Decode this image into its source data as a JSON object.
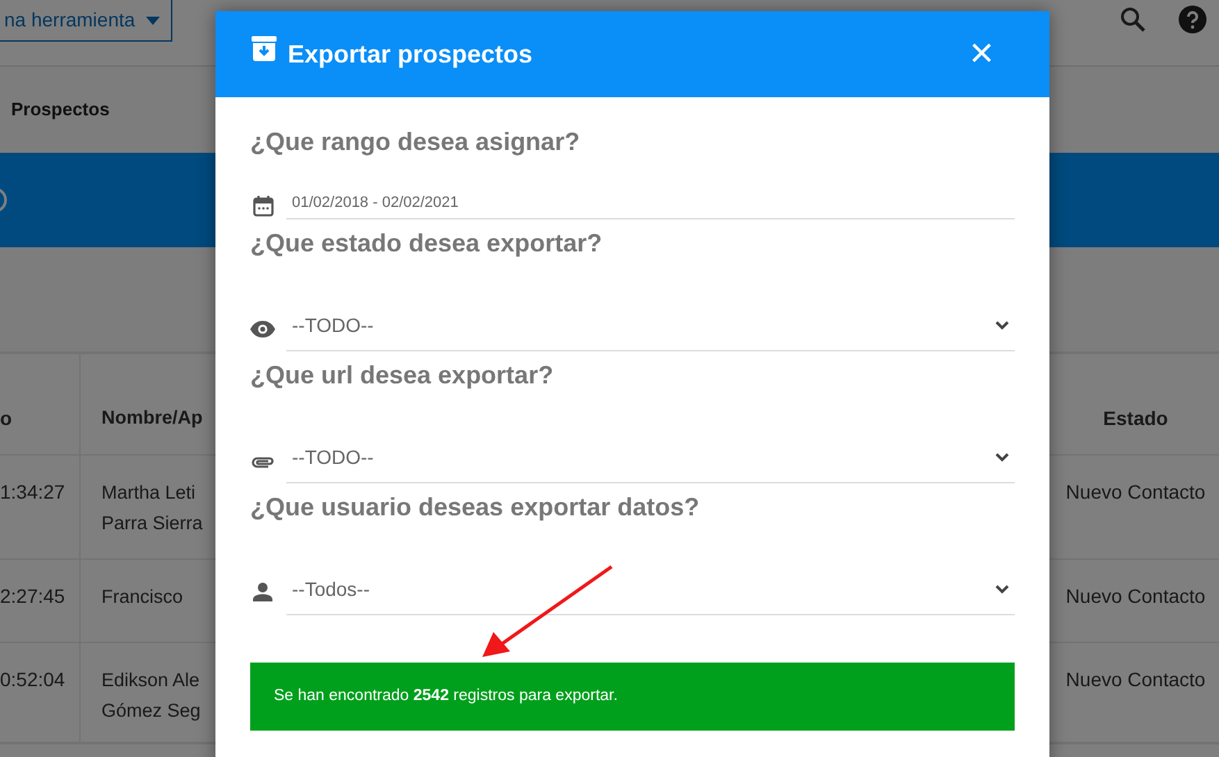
{
  "toolbar": {
    "tool_button": "na herramienta"
  },
  "page_title": "Prospectos",
  "table": {
    "columns": [
      "o",
      "Nombre/Ap",
      "Estado"
    ],
    "rows": [
      {
        "time": "1:34:27",
        "name": [
          "Martha Leti",
          "Parra Sierra"
        ],
        "estado": "Nuevo Contacto"
      },
      {
        "time": "2:27:45",
        "name": [
          "Francisco"
        ],
        "estado": "Nuevo Contacto"
      },
      {
        "time": "0:52:04",
        "name": [
          "Edikson Ale",
          "Gómez Seg"
        ],
        "estado": "Nuevo Contacto"
      }
    ]
  },
  "modal": {
    "title": "Exportar prospectos",
    "close": "×",
    "sections": [
      {
        "kind": "date",
        "question": "¿Que rango desea asignar?",
        "value": "01/02/2018 - 02/02/2021"
      },
      {
        "kind": "select",
        "question": "¿Que estado desea exportar?",
        "value": "--TODO--"
      },
      {
        "kind": "select",
        "question": "¿Que url desea exportar?",
        "value": "--TODO--"
      },
      {
        "kind": "select",
        "question": "¿Que usuario deseas exportar datos?",
        "value": "--Todos--"
      }
    ],
    "result": "Se han encontrado **2542** registros para exportar."
  }
}
